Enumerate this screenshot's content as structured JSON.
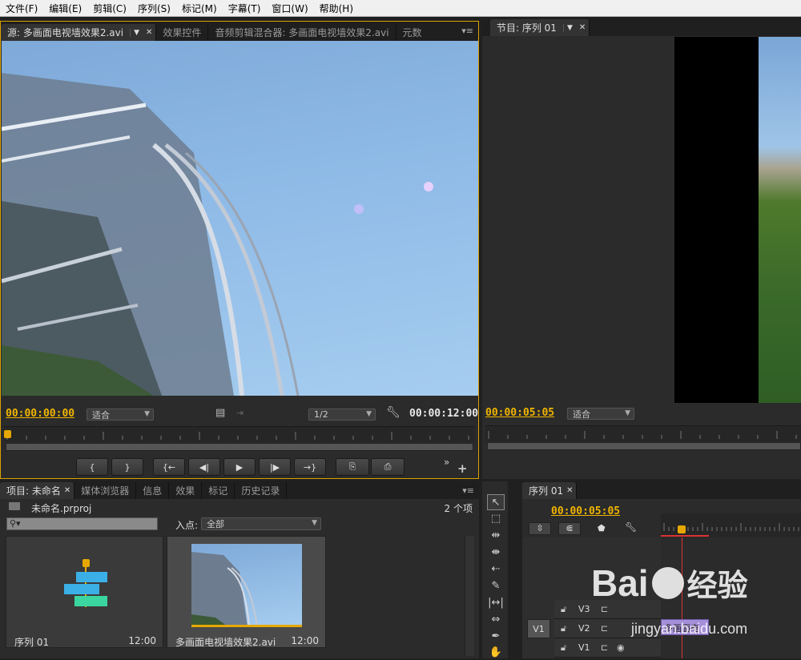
{
  "menu": [
    "文件(F)",
    "编辑(E)",
    "剪辑(C)",
    "序列(S)",
    "标记(M)",
    "字幕(T)",
    "窗口(W)",
    "帮助(H)"
  ],
  "source": {
    "tabs": [
      "源: 多画面电视墙效果2.avi",
      "效果控件",
      "音频剪辑混合器: 多画面电视墙效果2.avi",
      "元数"
    ],
    "timecode_in": "00:00:00:00",
    "fit": "适合",
    "resolution": "1/2",
    "duration": "00:00:12:00",
    "buttons": [
      "{",
      "}",
      "{←",
      "◀|",
      "▶",
      "|▶",
      "→}",
      "⎘",
      "⎙"
    ]
  },
  "program": {
    "tab": "节目: 序列 01",
    "timecode": "00:00:05:05",
    "fit": "适合"
  },
  "project": {
    "tabs": [
      "项目: 未命名",
      "媒体浏览器",
      "信息",
      "效果",
      "标记",
      "历史记录"
    ],
    "file": "未命名.prproj",
    "count": "2 个项",
    "in_point_label": "入点:",
    "in_point_value": "全部",
    "items": [
      {
        "name": "序列 01",
        "duration": "12:00"
      },
      {
        "name": "多画面电视墙效果2.avi",
        "duration": "12:00"
      }
    ]
  },
  "timeline": {
    "tab": "序列 01",
    "timecode": "00:00:05:05",
    "tracks": [
      "V3",
      "V2",
      "V1"
    ],
    "source_patch": "V1",
    "clip_label": "多画面电"
  },
  "watermark": {
    "brand": "Bai",
    "brand2": "经验",
    "url": "jingyan.baidu.com"
  }
}
